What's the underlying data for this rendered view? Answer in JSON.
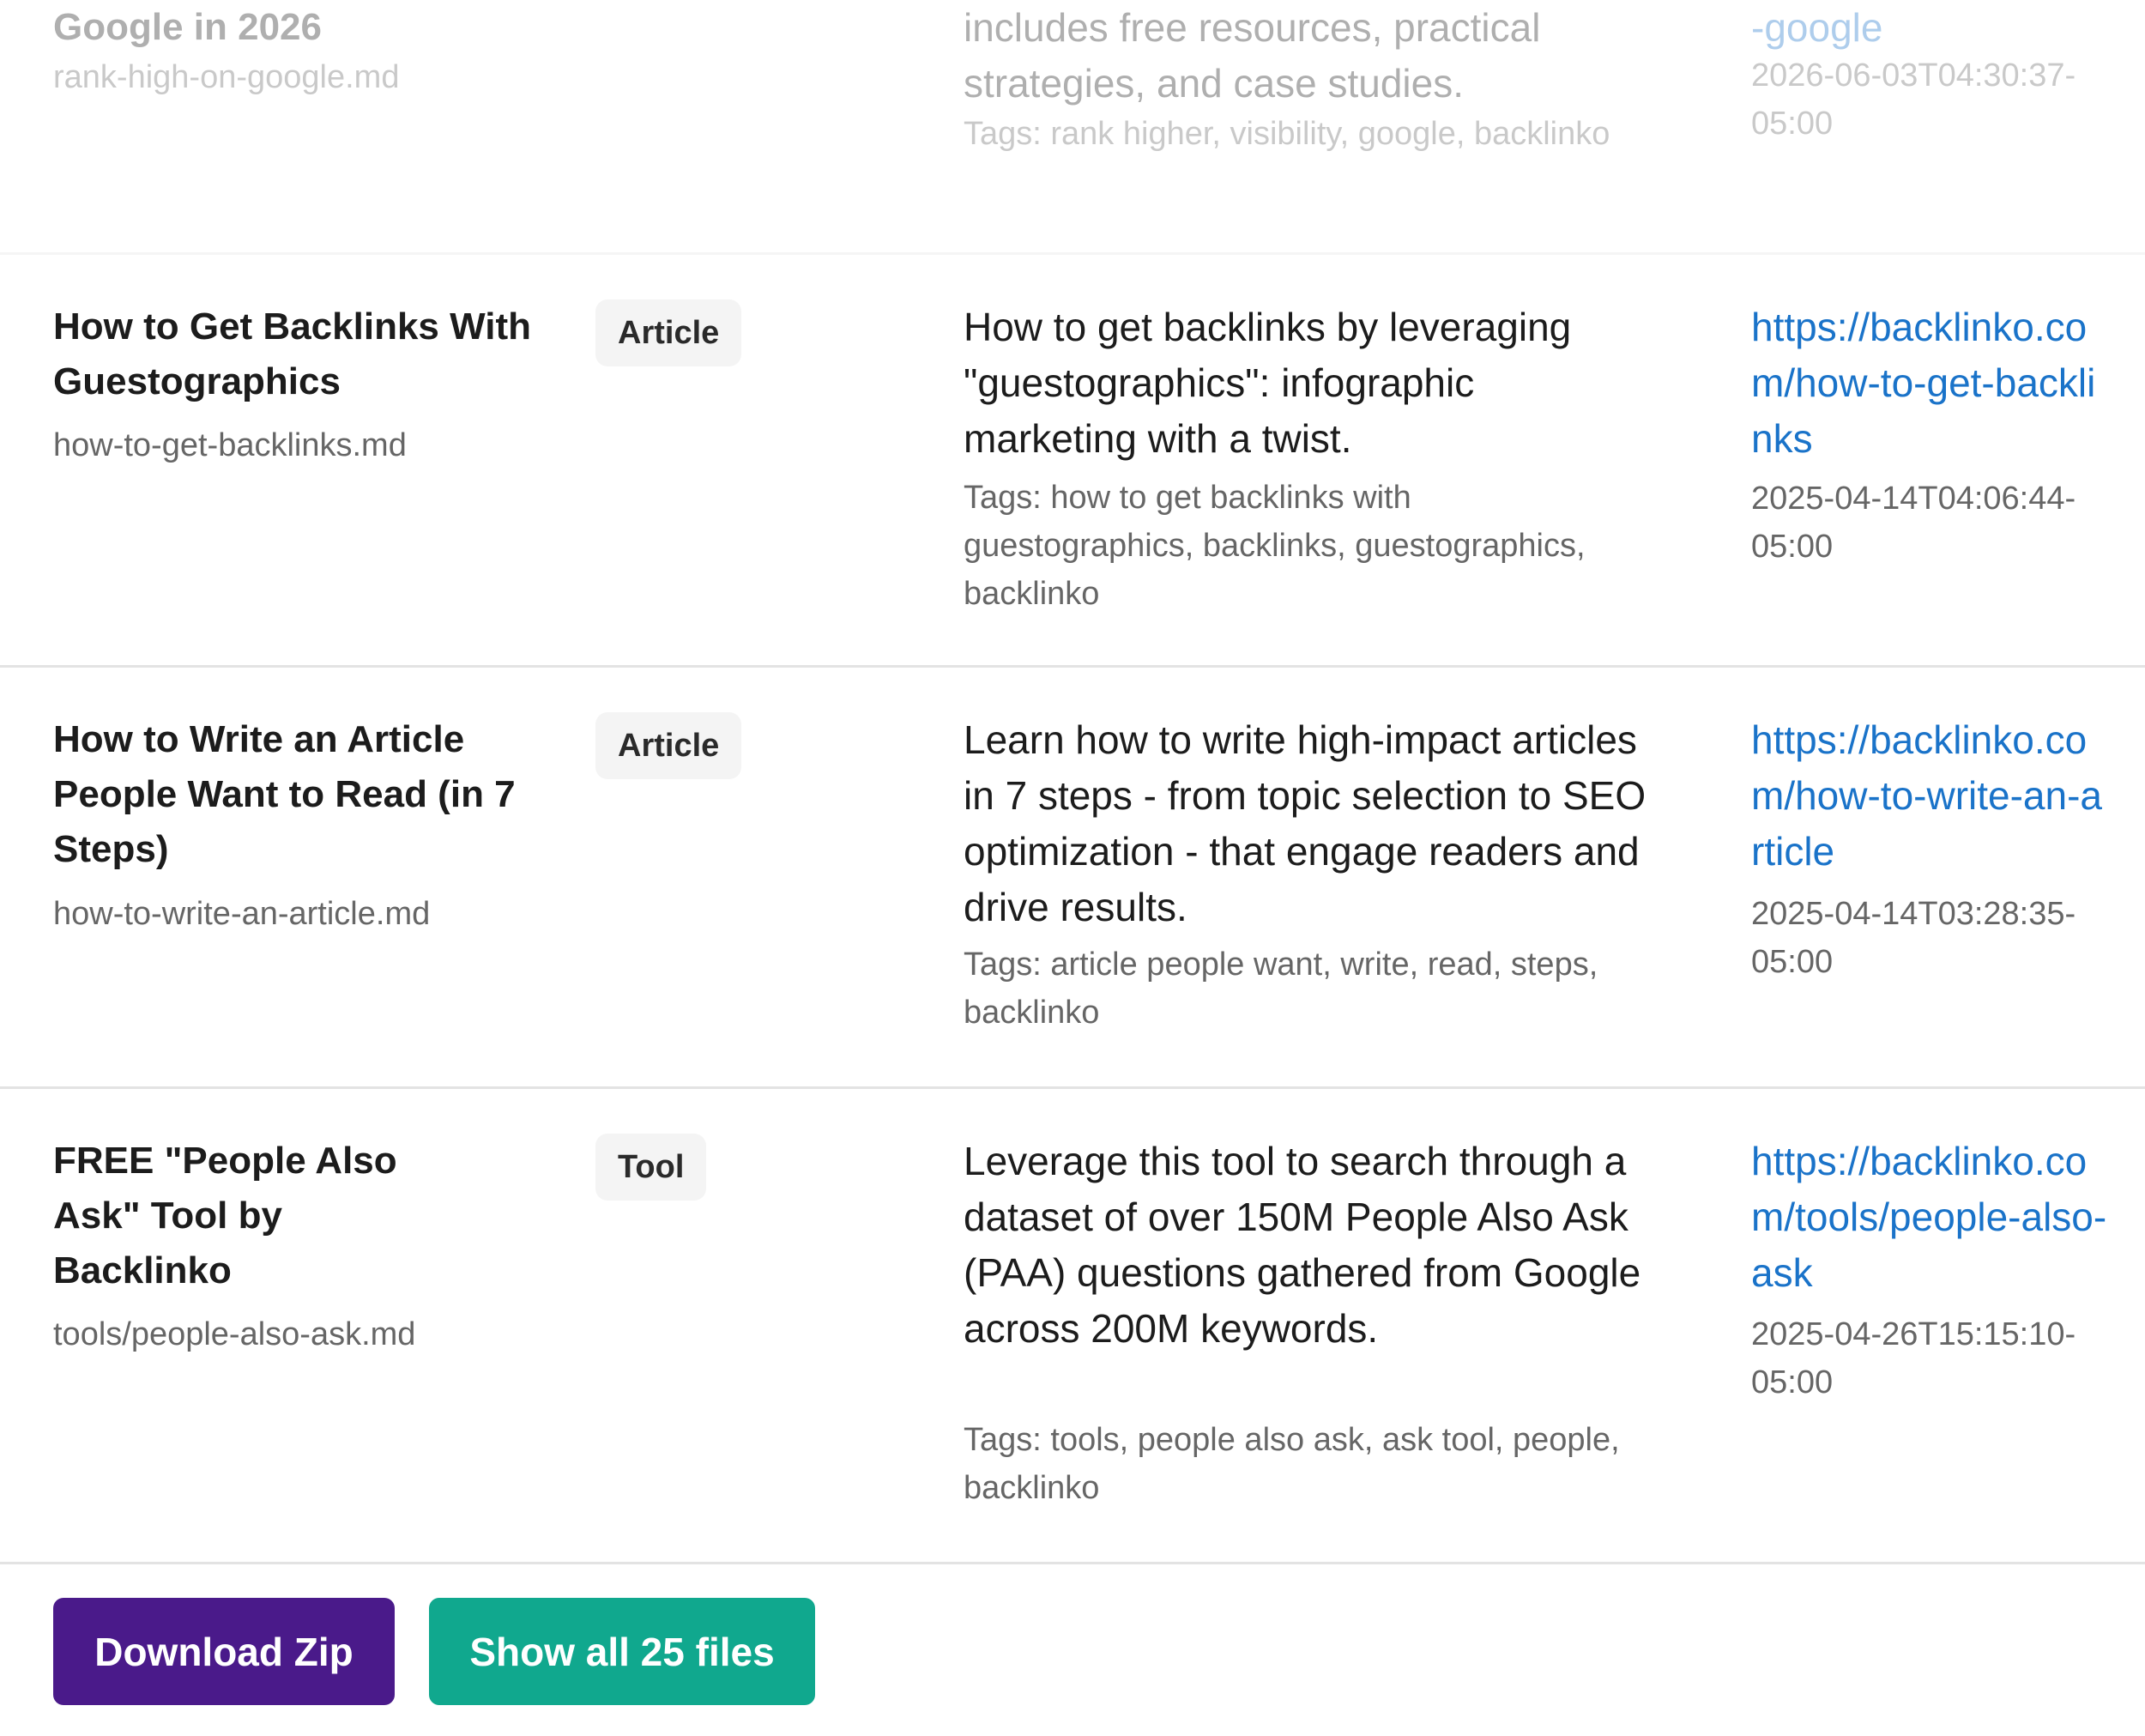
{
  "rows": [
    {
      "title": "Google in 2026",
      "filename": "rank-high-on-google.md",
      "description": "includes free resources, practical strategies, and case studies.",
      "tags": "Tags: rank higher, visibility, google, backlinko",
      "url": "-google",
      "date": "2026-06-03T04:30:37-05:00"
    },
    {
      "title": "How to Get Backlinks With Guestographics",
      "type": "Article",
      "filename": "how-to-get-backlinks.md",
      "description": "How to get backlinks by leveraging \"guestographics\": infographic marketing with a twist.",
      "tags": "Tags: how to get backlinks with guestographics, backlinks, guestographics, backlinko",
      "url": "https://backlinko.com/how-to-get-backlinks",
      "date": "2025-04-14T04:06:44-05:00"
    },
    {
      "title": "How to Write an Article People Want to Read (in 7 Steps)",
      "type": "Article",
      "filename": "how-to-write-an-article.md",
      "description": "Learn how to write high-impact articles in 7 steps - from topic selection to SEO optimization - that engage readers and drive results.",
      "tags": "Tags: article people want, write, read, steps, backlinko",
      "url": "https://backlinko.com/how-to-write-an-article",
      "date": "2025-04-14T03:28:35-05:00"
    },
    {
      "title": "FREE \"People Also Ask\" Tool by Backlinko",
      "type": "Tool",
      "filename": "tools/people-also-ask.md",
      "description": "Leverage this tool to search through a dataset of over 150M People Also Ask (PAA) questions gathered from Google across 200M keywords.",
      "tags": "Tags: tools, people also ask, ask tool, people, backlinko",
      "url": "https://backlinko.com/tools/people-also-ask",
      "date": "2025-04-26T15:15:10-05:00"
    }
  ],
  "actions": {
    "download_label": "Download Zip",
    "show_all_label": "Show all 25 files"
  },
  "colors": {
    "download_button": "#4a1a8a",
    "show_all_button": "#10a88e",
    "link": "#1a73c9"
  }
}
